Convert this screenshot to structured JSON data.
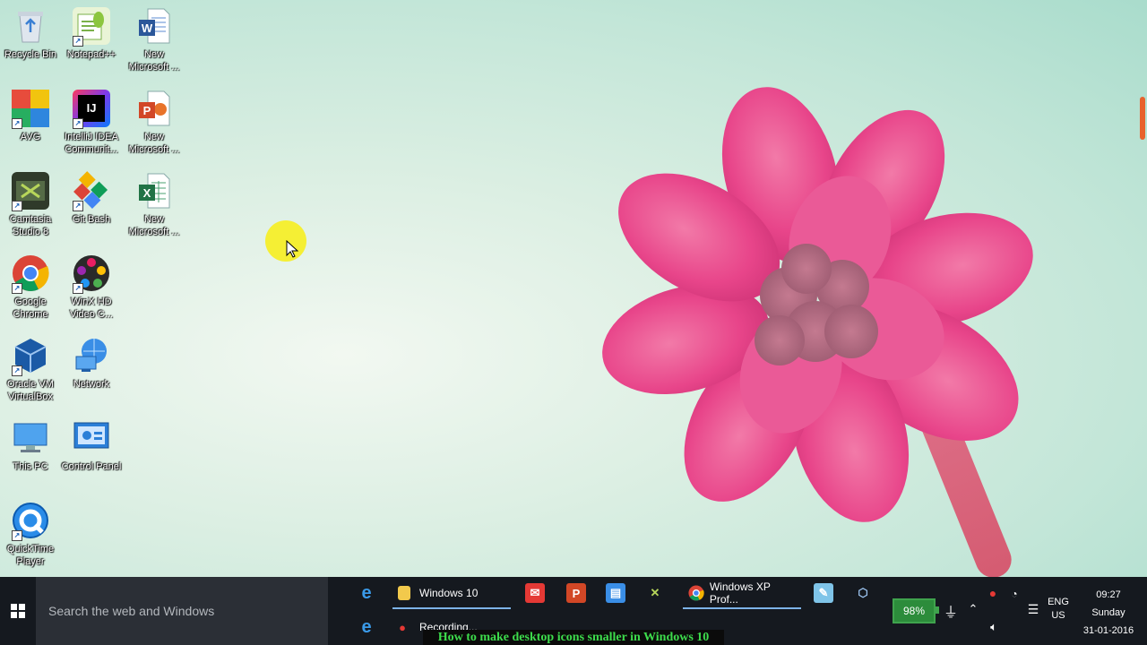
{
  "desktop": {
    "icons": [
      {
        "label": "Recycle Bin",
        "icon": "recycle-bin-icon"
      },
      {
        "label": "Notepad++",
        "icon": "notepad-plus-plus-icon"
      },
      {
        "label": "New Microsoft ...",
        "icon": "word-document-icon"
      },
      {
        "label": "AVG",
        "icon": "avg-icon"
      },
      {
        "label": "IntelliJ IDEA Communit...",
        "icon": "intellij-idea-icon"
      },
      {
        "label": "New Microsoft ...",
        "icon": "powerpoint-document-icon"
      },
      {
        "label": "Camtasia Studio 8",
        "icon": "camtasia-icon"
      },
      {
        "label": "Git Bash",
        "icon": "git-bash-icon"
      },
      {
        "label": "New Microsoft ...",
        "icon": "excel-document-icon"
      },
      {
        "label": "Google Chrome",
        "icon": "chrome-icon"
      },
      {
        "label": "WinX HD Video C...",
        "icon": "winx-video-icon"
      },
      {
        "label": "Oracle VM VirtualBox",
        "icon": "virtualbox-icon"
      },
      {
        "label": "Network",
        "icon": "network-icon"
      },
      {
        "label": "This PC",
        "icon": "this-pc-icon"
      },
      {
        "label": "Control Panel",
        "icon": "control-panel-icon"
      },
      {
        "label": "QuickTime Player",
        "icon": "quicktime-icon"
      }
    ]
  },
  "taskbar": {
    "search_placeholder": "Search the web and Windows",
    "items": [
      {
        "label": "Windows 10",
        "icon": "folder-icon"
      },
      {
        "label": "Windows XP Prof...",
        "icon": "chrome-icon"
      },
      {
        "label": "Recording...",
        "icon": "camtasia-recorder-icon"
      }
    ],
    "tray": {
      "battery": "98%",
      "language_top": "ENG",
      "language_bottom": "US",
      "time": "09:27",
      "day": "Sunday",
      "date": "31-01-2016"
    }
  },
  "caption": "How to make desktop icons smaller in Windows 10",
  "colors": {
    "taskbar": "#15191f",
    "search_box": "#2b2f36",
    "flower": "#e8458a",
    "caption_text": "#3ddc4c",
    "cursor_halo": "#f5ee2a"
  }
}
